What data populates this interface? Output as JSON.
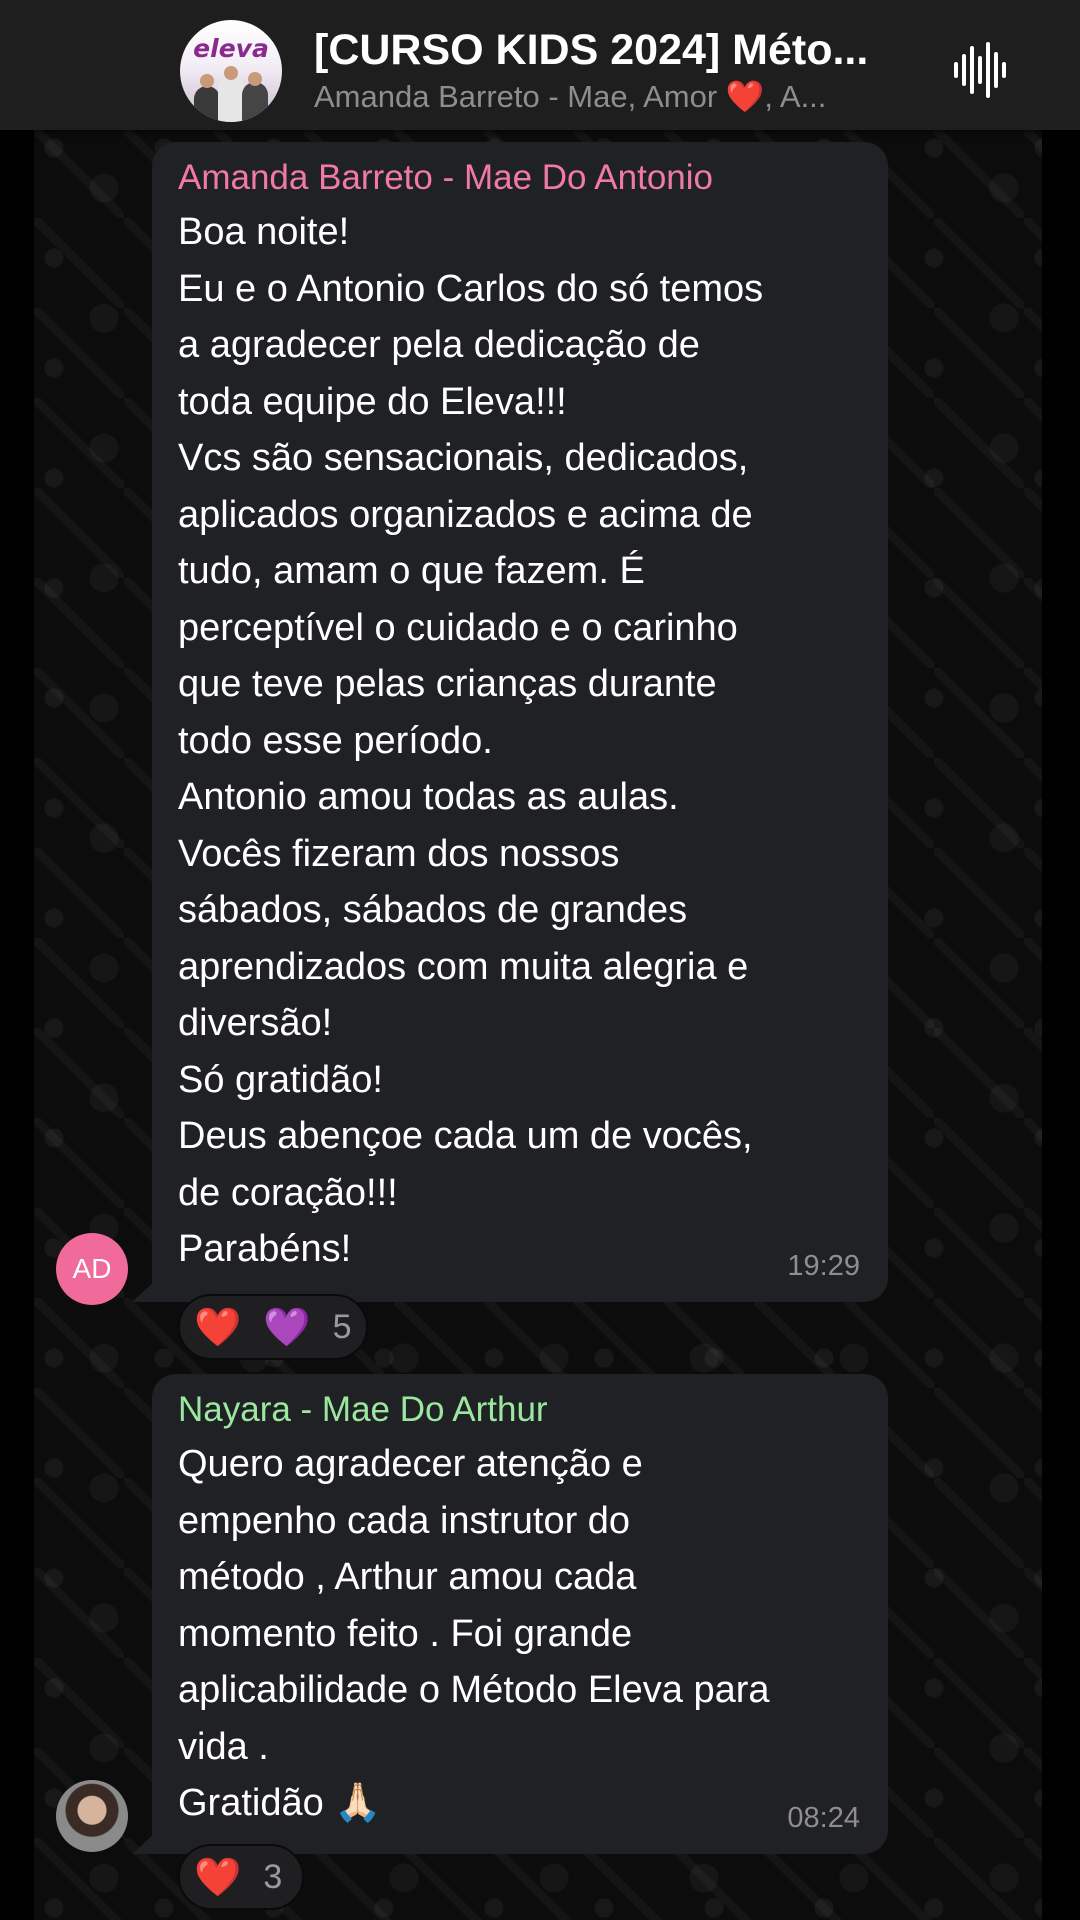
{
  "header": {
    "title": "[CURSO KIDS 2024] Méto...",
    "subtitle": "Amanda Barreto - Mae, Amor ❤️, A...",
    "avatar_logo": "eleva",
    "audio_icon": "audio-waveform-icon"
  },
  "messages": [
    {
      "sender": "Amanda Barreto - Mae Do Antonio",
      "sender_color": "#f07aa3",
      "avatar_initials": "AD",
      "avatar_color": "#f06b9a",
      "lines": [
        "Boa noite!",
        "Eu e o Antonio Carlos do só temos",
        "a agradecer pela dedicação de",
        "toda equipe do Eleva!!!",
        "Vcs são sensacionais, dedicados,",
        "aplicados organizados e acima de",
        "tudo, amam o que fazem. É",
        "perceptível o cuidado e o carinho",
        "que teve pelas crianças durante",
        "todo esse período.",
        "Antonio amou todas as aulas.",
        "Vocês fizeram dos nossos",
        "sábados, sábados de grandes",
        "aprendizados com muita alegria e",
        "diversão!",
        "Só gratidão!",
        "Deus abençoe cada um de vocês,",
        "de coração!!!",
        "Parabéns!"
      ],
      "time": "19:29",
      "reactions": {
        "emoji_1": "❤️",
        "emoji_2": "💜",
        "count": "5"
      }
    },
    {
      "sender": "Nayara - Mae Do Arthur",
      "sender_color": "#9be7a0",
      "lines": [
        "Quero agradecer atenção e",
        "empenho cada instrutor do",
        "método , Arthur amou cada",
        "momento feito . Foi grande",
        "aplicabilidade o Método Eleva para",
        "vida .",
        "Gratidão 🙏🏻"
      ],
      "time": "08:24",
      "reactions": {
        "emoji_1": "❤️",
        "count": "3"
      }
    }
  ],
  "colors": {
    "background": "#000000",
    "header": "#1e1e1e",
    "bubble": "#202124",
    "text": "#ffffff",
    "meta": "#8d8d92"
  }
}
